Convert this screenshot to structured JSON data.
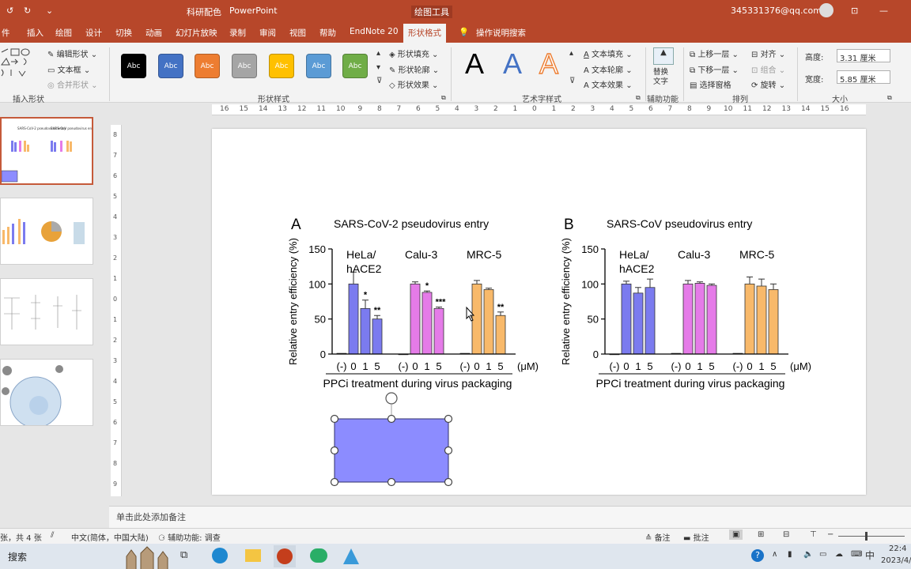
{
  "titlebar": {
    "doc_name": "科研配色",
    "app_name": "PowerPoint",
    "context_tab": "绘图工具",
    "account": "345331376@qq.com"
  },
  "ribbon_tabs": [
    "件",
    "插入",
    "绘图",
    "设计",
    "切换",
    "动画",
    "幻灯片放映",
    "录制",
    "审阅",
    "视图",
    "帮助",
    "EndNote 20",
    "形状格式",
    "操作说明搜索"
  ],
  "ribbon": {
    "insert_shapes": {
      "edit_shape": "编辑形状",
      "text_box": "文本框",
      "merge_shapes": "合并形状",
      "group_label": "插入形状"
    },
    "shape_styles": {
      "swatches": [
        {
          "label": "Abc",
          "color": "#000000"
        },
        {
          "label": "Abc",
          "color": "#4472c4"
        },
        {
          "label": "Abc",
          "color": "#ed7d31"
        },
        {
          "label": "Abc",
          "color": "#a5a5a5"
        },
        {
          "label": "Abc",
          "color": "#ffc000"
        },
        {
          "label": "Abc",
          "color": "#5b9bd5"
        },
        {
          "label": "Abc",
          "color": "#70ad47"
        }
      ],
      "fill": "形状填充",
      "outline": "形状轮廓",
      "effects": "形状效果",
      "group_label": "形状样式"
    },
    "wordart": {
      "letters": [
        "A",
        "A",
        "A"
      ],
      "text_fill": "文本填充",
      "text_outline": "文本轮廓",
      "text_effects": "文本效果",
      "group_label": "艺术字样式"
    },
    "accessibility": {
      "alt_text": "替换文字",
      "group_label": "辅助功能"
    },
    "arrange": {
      "bring_forward": "上移一层",
      "send_backward": "下移一层",
      "selection_pane": "选择窗格",
      "align": "对齐",
      "group": "组合",
      "rotate": "旋转",
      "group_label": "排列"
    },
    "size": {
      "height_label": "高度:",
      "height_value": "3.31 厘米",
      "width_label": "宽度:",
      "width_value": "5.85 厘米",
      "group_label": "大小"
    }
  },
  "ruler": {
    "labels": [
      "16",
      "15",
      "14",
      "13",
      "12",
      "11",
      "10",
      "9",
      "8",
      "7",
      "6",
      "5",
      "4",
      "3",
      "2",
      "1",
      "0",
      "1",
      "2",
      "3",
      "4",
      "5",
      "6",
      "7",
      "8",
      "9",
      "10",
      "11",
      "12",
      "13",
      "14",
      "15",
      "16"
    ]
  },
  "slide": {
    "accent_shape_color": "#8c8cff",
    "panels": [
      {
        "letter": "A",
        "title": "SARS-CoV-2 pseudovirus entry",
        "ylabel": "Relative entry efficiency (%)",
        "xlabel": "PPCi treatment during virus packaging",
        "unit": "(μM)",
        "yticks": [
          "150",
          "100",
          "50",
          "0"
        ],
        "groups": [
          {
            "name": [
              "HeLa/",
              "hACE2"
            ],
            "color": "#7b7bef",
            "values": [
              1,
              100,
              65,
              50
            ],
            "err": [
              0,
              17,
              12,
              5
            ],
            "sig": [
              "",
              "",
              "*",
              "**"
            ]
          },
          {
            "name": [
              "Calu-3"
            ],
            "color": "#e57be8",
            "values": [
              0,
              100,
              88,
              65
            ],
            "err": [
              0,
              3,
              2,
              2
            ],
            "sig": [
              "",
              "",
              "*",
              "***"
            ]
          },
          {
            "name": [
              "MRC-5"
            ],
            "color": "#f8b96a",
            "values": [
              1,
              100,
              92,
              55
            ],
            "err": [
              0,
              5,
              2,
              5
            ],
            "sig": [
              "",
              "",
              "",
              "**"
            ]
          }
        ],
        "ticklabels": [
          "(-)",
          "0",
          "1",
          "5"
        ]
      },
      {
        "letter": "B",
        "title": "SARS-CoV pseudovirus entry",
        "ylabel": "Relative entry efficiency (%)",
        "xlabel": "PPCi treatment during virus packaging",
        "unit": "(μM)",
        "yticks": [
          "150",
          "100",
          "50",
          "0"
        ],
        "groups": [
          {
            "name": [
              "HeLa/",
              "hACE2"
            ],
            "color": "#7b7bef",
            "values": [
              0,
              100,
              87,
              95
            ],
            "err": [
              0,
              4,
              8,
              12
            ],
            "sig": [
              "",
              "",
              "",
              ""
            ]
          },
          {
            "name": [
              "Calu-3"
            ],
            "color": "#e57be8",
            "values": [
              1,
              100,
              101,
              98
            ],
            "err": [
              0,
              5,
              2,
              2
            ],
            "sig": [
              "",
              "",
              "",
              ""
            ]
          },
          {
            "name": [
              "MRC-5"
            ],
            "color": "#f8b96a",
            "values": [
              1,
              100,
              97,
              92
            ],
            "err": [
              0,
              10,
              10,
              8
            ],
            "sig": [
              "",
              "",
              "",
              ""
            ]
          }
        ],
        "ticklabels": [
          "(-)",
          "0",
          "1",
          "5"
        ]
      }
    ]
  },
  "notes_placeholder": "单击此处添加备注",
  "status": {
    "slide_count": "张，共 4 张",
    "language": "中文(简体，中国大陆)",
    "accessibility": "辅助功能: 调查",
    "notes_btn": "备注",
    "comments_btn": "批注"
  },
  "taskbar": {
    "search": "搜索",
    "ime": "中",
    "time": "22:4",
    "date": "2023/4/"
  }
}
